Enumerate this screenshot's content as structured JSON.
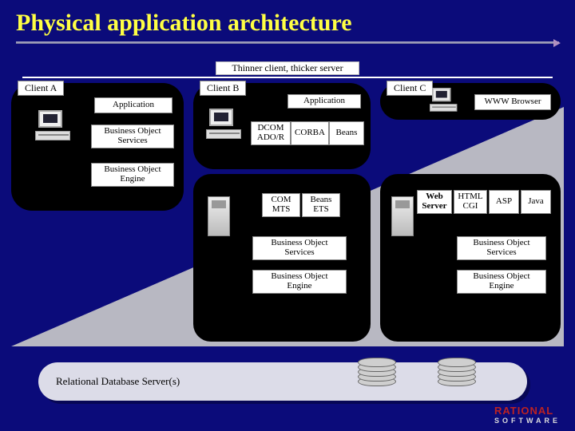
{
  "title": "Physical application architecture",
  "axis_caption": "Thinner client, thicker server",
  "clients": {
    "a": {
      "tag": "Client A",
      "app": "Application",
      "svc": "Business Object\nServices",
      "eng": "Business Object\nEngine"
    },
    "b": {
      "tag": "Client B",
      "app": "Application",
      "t1": "DCOM\nADO/R",
      "t2": "CORBA",
      "t3": "Beans"
    },
    "c": {
      "tag": "Client C",
      "browser": "WWW Browser"
    }
  },
  "serverB": {
    "r1a": "COM\nMTS",
    "r1b": "Beans\nETS",
    "svc": "Business Object\nServices",
    "eng": "Business Object\nEngine"
  },
  "serverC": {
    "ws": "Web\nServer",
    "h1": "HTML\nCGI",
    "h2": "ASP",
    "h3": "Java",
    "svc": "Business Object\nServices",
    "eng": "Business Object\nEngine"
  },
  "footer": "Relational Database Server(s)",
  "logo": {
    "brand": "RATIONAL",
    "sub": "SOFTWARE"
  }
}
